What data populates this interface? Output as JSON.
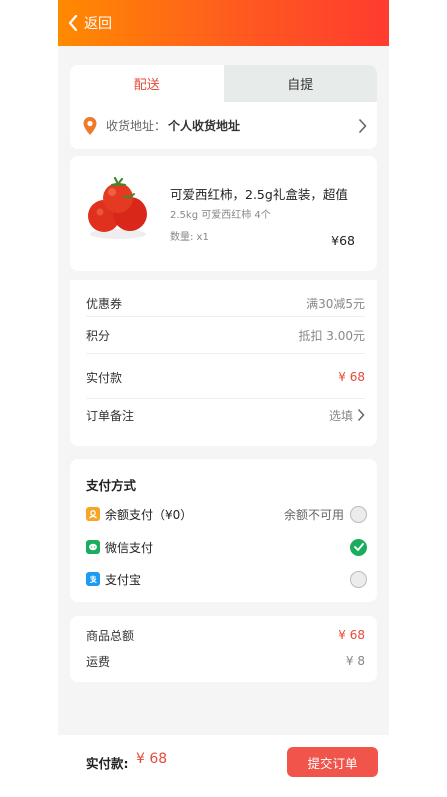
{
  "header": {
    "back_label": "返回"
  },
  "delivery": {
    "tabs": [
      {
        "label": "配送"
      },
      {
        "label": "自提"
      }
    ],
    "address_label": "收货地址：",
    "address_value": "个人收货地址"
  },
  "product": {
    "title": "可爱西红柿，2.5g礼盒装，超值",
    "spec": "2.5kg  可爱西红柿 4个",
    "quantity": "数量:  x1",
    "price": "¥68"
  },
  "summary": {
    "coupon_label": "优惠券",
    "coupon_value": "满30减5元",
    "points_label": "积分",
    "points_value": "抵扣 3.00元",
    "paid_label": "实付款",
    "paid_value": "¥ 68",
    "remark_label": "订单备注",
    "remark_value": "选填"
  },
  "payment": {
    "title": "支付方式",
    "options": [
      {
        "label": "余额支付（¥0）",
        "note": "余额不可用",
        "selected": false,
        "icon": "wallet-icon"
      },
      {
        "label": "微信支付",
        "selected": true,
        "icon": "wechat-icon"
      },
      {
        "label": "支付宝",
        "selected": false,
        "icon": "alipay-icon"
      }
    ]
  },
  "totals": {
    "goods_label": "商品总额",
    "goods_value": "¥ 68",
    "shipping_label": "运费",
    "shipping_value": "¥ 8"
  },
  "bottom_bar": {
    "paid_label": "实付款:",
    "paid_amount": "¥ 68",
    "submit_label": "提交订单"
  },
  "colors": {
    "accent": "#e84a3a",
    "header_start": "#ff8a00",
    "header_end": "#ff3b2f",
    "wechat_green": "#1aad5e"
  }
}
